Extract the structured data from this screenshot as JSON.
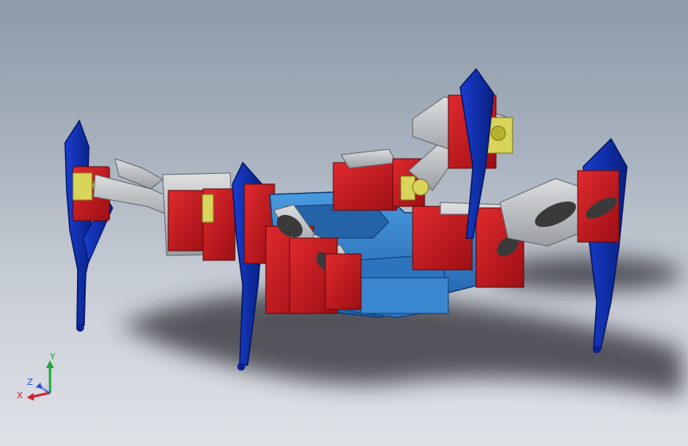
{
  "viewport": {
    "background_top": "#8e9aa9",
    "background_bottom": "#dfe2e7"
  },
  "model": {
    "colors": {
      "leg": "#0b2aa8",
      "servo": "#c8151b",
      "bracket": "#b9bcc0",
      "body": "#3a86cf",
      "horn": "#d9d45a",
      "shadow": "#2a2c30"
    }
  },
  "triad": {
    "x_label": "X",
    "y_label": "Y",
    "z_label": "Z",
    "x_color": "#d0202a",
    "y_color": "#1fa83a",
    "z_color": "#2a4fd0"
  }
}
